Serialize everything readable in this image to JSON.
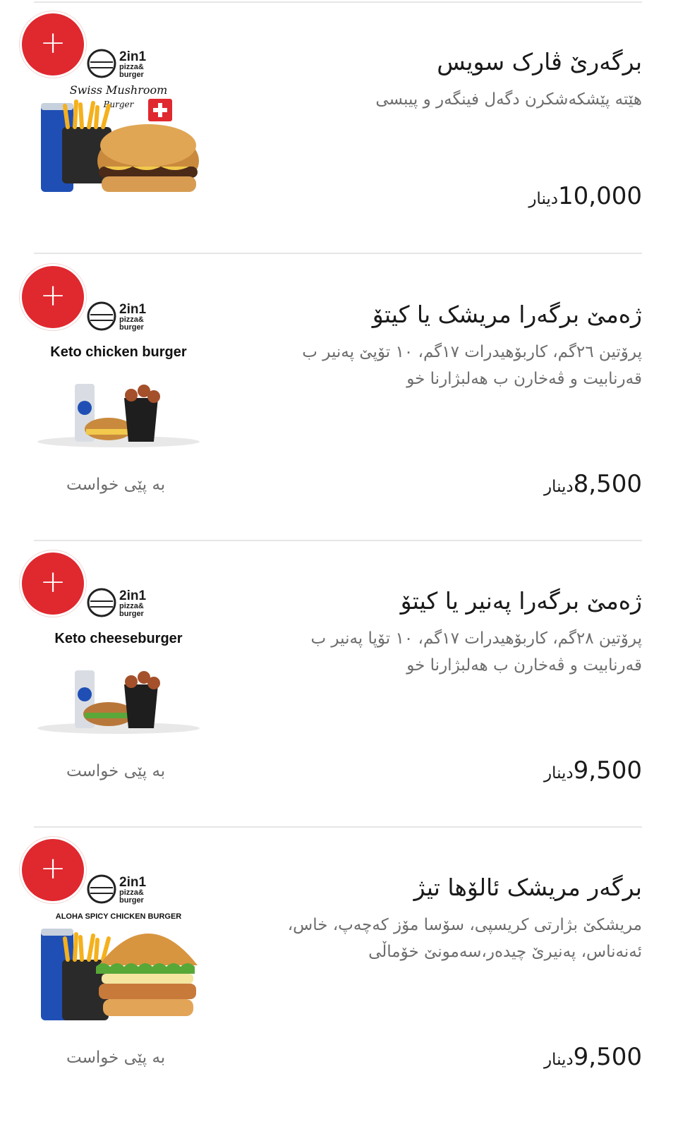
{
  "currency": "دینار",
  "items": [
    {
      "title": "برگەرێ ڤارک سویس",
      "description": "هێتە پێشکەشکرن دگەل فینگەر و پیبسی",
      "price": "10,000",
      "custom_label": "",
      "logo": {
        "brand": "2in1",
        "sub1": "pizza&",
        "sub2": "burger"
      },
      "image_caption": "Swiss Mushroom",
      "image_subcaption": "Burger"
    },
    {
      "title": "ژەمێ برگەرا مریشک یا کیتۆ",
      "description": "پرۆتین ٢٦گم، کاربۆهیدرات ١٧گم، ١٠ تۆپێ پەنیر ب قەرنابیت و ڤەخارن ب هەلبژارنا خو",
      "price": "8,500",
      "custom_label": "بە پێی خواست",
      "logo": {
        "brand": "2in1",
        "sub1": "pizza&",
        "sub2": "burger"
      },
      "image_caption": "Keto chicken burger",
      "image_subcaption": ""
    },
    {
      "title": "ژەمێ برگەرا پەنیر یا کیتۆ",
      "description": "پرۆتین ٢٨گم، کاربۆهیدرات ١٧گم، ١٠ تۆپا پەنیر ب قەرنابیت و ڤەخارن ب هەلبژارنا خو",
      "price": "9,500",
      "custom_label": "بە پێی خواست",
      "logo": {
        "brand": "2in1",
        "sub1": "pizza&",
        "sub2": "burger"
      },
      "image_caption": "Keto cheeseburger",
      "image_subcaption": ""
    },
    {
      "title": "برگەر مریشک ئالۆها تیژ",
      "description": "مریشکێ بژارتی کریسپی، سۆسا مۆز کەچەپ، خاس، ئەنەناس، پەنیرێ چیدەر،سەمونێ خۆماڵی",
      "price": "9,500",
      "custom_label": "بە پێی خواست",
      "logo": {
        "brand": "2in1",
        "sub1": "pizza&",
        "sub2": "burger"
      },
      "image_caption": "ALOHA SPICY CHICKEN BURGER",
      "image_subcaption": ""
    }
  ],
  "colors": {
    "add_button": "#e0282f",
    "divider": "#e6e6e6",
    "muted_text": "#6d6d6d"
  },
  "icons": {
    "add": "plus-icon"
  }
}
